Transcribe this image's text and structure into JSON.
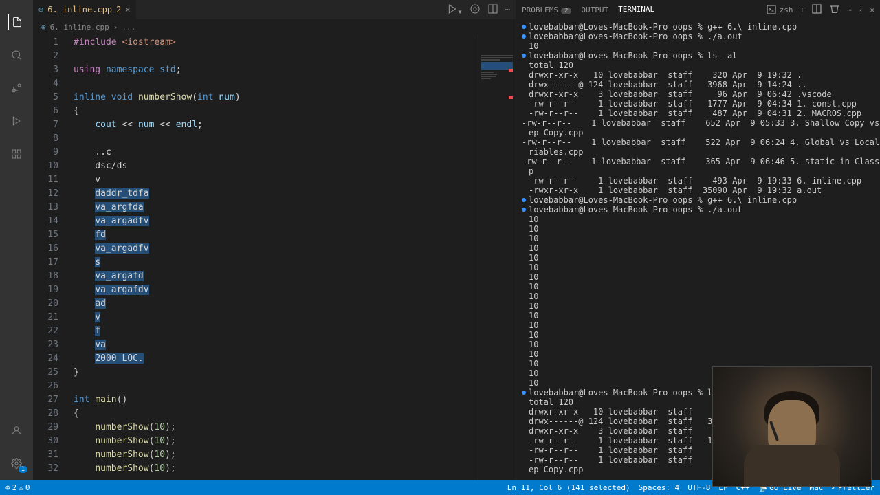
{
  "tab": {
    "icon": "cpp-icon",
    "filename": "6. inline.cpp",
    "modified_count": "2",
    "close": "×"
  },
  "breadcrumb": {
    "icon": "cpp-icon",
    "file": "6. inline.cpp",
    "sep": "›",
    "more": "..."
  },
  "code_lines": [
    {
      "n": 1,
      "html": "<span class='kw-purple'>#include</span> <span class='str'>&lt;iostream&gt;</span>"
    },
    {
      "n": 2,
      "html": ""
    },
    {
      "n": 3,
      "html": "<span class='kw-purple'>using</span> <span class='kw-blue'>namespace</span> <span class='kw-type'>std</span>;"
    },
    {
      "n": 4,
      "html": ""
    },
    {
      "n": 5,
      "html": "<span class='kw-blue'>inline</span> <span class='kw-blue'>void</span> <span class='fn-name'>numberShow</span>(<span class='kw-blue'>int</span> <span class='param'>num</span>)"
    },
    {
      "n": 6,
      "html": "{"
    },
    {
      "n": 7,
      "html": "    <span class='var'>cout</span> &lt;&lt; <span class='param'>num</span> &lt;&lt; <span class='var'>endl</span>;"
    },
    {
      "n": 8,
      "html": ""
    },
    {
      "n": 9,
      "html": "    ..c"
    },
    {
      "n": 10,
      "html": "    dsc/ds"
    },
    {
      "n": 11,
      "html": "    v"
    },
    {
      "n": 12,
      "html": "    <span class='sel'>daddr_tdfa</span>"
    },
    {
      "n": 13,
      "html": "    <span class='sel'>va_argfda</span>"
    },
    {
      "n": 14,
      "html": "    <span class='sel'>va_argadfv</span>"
    },
    {
      "n": 15,
      "html": "    <span class='sel'>fd</span>"
    },
    {
      "n": 16,
      "html": "    <span class='sel'>va_argadfv</span>"
    },
    {
      "n": 17,
      "html": "    <span class='sel'>s</span>"
    },
    {
      "n": 18,
      "html": "    <span class='sel'>va_argafd</span>"
    },
    {
      "n": 19,
      "html": "    <span class='sel'>va_argafdv</span>"
    },
    {
      "n": 20,
      "html": "    <span class='sel'>ad</span>"
    },
    {
      "n": 21,
      "html": "    <span class='sel'>v</span>"
    },
    {
      "n": 22,
      "html": "    <span class='sel'>f</span>"
    },
    {
      "n": 23,
      "html": "    <span class='sel'>va</span>"
    },
    {
      "n": 24,
      "html": "    <span class='sel'>2000 LOC.</span>"
    },
    {
      "n": 25,
      "html": "}"
    },
    {
      "n": 26,
      "html": ""
    },
    {
      "n": 27,
      "html": "<span class='kw-blue'>int</span> <span class='fn-name'>main</span>()"
    },
    {
      "n": 28,
      "html": "{"
    },
    {
      "n": 29,
      "html": "    <span class='fn-name'>numberShow</span>(<span class='num'>10</span>);"
    },
    {
      "n": 30,
      "html": "    <span class='fn-name'>numberShow</span>(<span class='num'>10</span>);"
    },
    {
      "n": 31,
      "html": "    <span class='fn-name'>numberShow</span>(<span class='num'>10</span>);"
    },
    {
      "n": 32,
      "html": "    <span class='fn-name'>numberShow</span>(<span class='num'>10</span>);"
    }
  ],
  "terminal_tabs": {
    "problems": "PROBLEMS",
    "problems_count": "2",
    "output": "OUTPUT",
    "terminal": "TERMINAL",
    "shell": "zsh"
  },
  "terminal_lines": [
    {
      "dot": true,
      "text": "lovebabbar@Loves-MacBook-Pro oops % g++ 6.\\ inline.cpp"
    },
    {
      "dot": true,
      "text": "lovebabbar@Loves-MacBook-Pro oops % ./a.out"
    },
    {
      "dot": false,
      "text": "10"
    },
    {
      "dot": true,
      "text": "lovebabbar@Loves-MacBook-Pro oops % ls -al"
    },
    {
      "dot": false,
      "text": "total 120"
    },
    {
      "dot": false,
      "text": "drwxr-xr-x   10 lovebabbar  staff    320 Apr  9 19:32 ."
    },
    {
      "dot": false,
      "text": "drwx------@ 124 lovebabbar  staff   3968 Apr  9 14:24 .."
    },
    {
      "dot": false,
      "text": "drwxr-xr-x    3 lovebabbar  staff     96 Apr  9 06:42 .vscode"
    },
    {
      "dot": false,
      "text": "-rw-r--r--    1 lovebabbar  staff   1777 Apr  9 04:34 1. const.cpp"
    },
    {
      "dot": false,
      "text": "-rw-r--r--    1 lovebabbar  staff    487 Apr  9 04:31 2. MACROS.cpp"
    },
    {
      "dot": false,
      "text": "-rw-r--r--    1 lovebabbar  staff    652 Apr  9 05:33 3. Shallow Copy vs De"
    },
    {
      "dot": false,
      "text": "ep Copy.cpp"
    },
    {
      "dot": false,
      "text": "-rw-r--r--    1 lovebabbar  staff    522 Apr  9 06:24 4. Global vs Local va"
    },
    {
      "dot": false,
      "text": "riables.cpp"
    },
    {
      "dot": false,
      "text": "-rw-r--r--    1 lovebabbar  staff    365 Apr  9 06:46 5. static in Class.cp"
    },
    {
      "dot": false,
      "text": "p"
    },
    {
      "dot": false,
      "text": "-rw-r--r--    1 lovebabbar  staff    493 Apr  9 19:33 6. inline.cpp"
    },
    {
      "dot": false,
      "text": "-rwxr-xr-x    1 lovebabbar  staff  35090 Apr  9 19:32 a.out"
    },
    {
      "dot": true,
      "text": "lovebabbar@Loves-MacBook-Pro oops % g++ 6.\\ inline.cpp"
    },
    {
      "dot": true,
      "text": "lovebabbar@Loves-MacBook-Pro oops % ./a.out"
    },
    {
      "dot": false,
      "text": "10"
    },
    {
      "dot": false,
      "text": "10"
    },
    {
      "dot": false,
      "text": "10"
    },
    {
      "dot": false,
      "text": "10"
    },
    {
      "dot": false,
      "text": "10"
    },
    {
      "dot": false,
      "text": "10"
    },
    {
      "dot": false,
      "text": "10"
    },
    {
      "dot": false,
      "text": "10"
    },
    {
      "dot": false,
      "text": "10"
    },
    {
      "dot": false,
      "text": "10"
    },
    {
      "dot": false,
      "text": "10"
    },
    {
      "dot": false,
      "text": "10"
    },
    {
      "dot": false,
      "text": "10"
    },
    {
      "dot": false,
      "text": "10"
    },
    {
      "dot": false,
      "text": "10"
    },
    {
      "dot": false,
      "text": "10"
    },
    {
      "dot": false,
      "text": "10"
    },
    {
      "dot": false,
      "text": "10"
    },
    {
      "dot": true,
      "text": "lovebabbar@Loves-MacBook-Pro oops % ls"
    },
    {
      "dot": false,
      "text": "total 120"
    },
    {
      "dot": false,
      "text": "drwxr-xr-x   10 lovebabbar  staff    320"
    },
    {
      "dot": false,
      "text": "drwx------@ 124 lovebabbar  staff   3968"
    },
    {
      "dot": false,
      "text": "drwxr-xr-x    3 lovebabbar  staff     96"
    },
    {
      "dot": false,
      "text": "-rw-r--r--    1 lovebabbar  staff   1777"
    },
    {
      "dot": false,
      "text": "-rw-r--r--    1 lovebabbar  staff    487"
    },
    {
      "dot": false,
      "text": "-rw-r--r--    1 lovebabbar  staff    652"
    },
    {
      "dot": false,
      "text": "ep Copy.cpp"
    }
  ],
  "status": {
    "errors": "2",
    "warnings": "0",
    "cursor": "Ln 11, Col 6 (141 selected)",
    "spaces": "Spaces: 4",
    "encoding": "UTF-8",
    "eol": "LF",
    "lang": "C++",
    "golive": "Go Live",
    "mac": "Mac",
    "prettier": "Prettier"
  },
  "activity_badge": "1"
}
